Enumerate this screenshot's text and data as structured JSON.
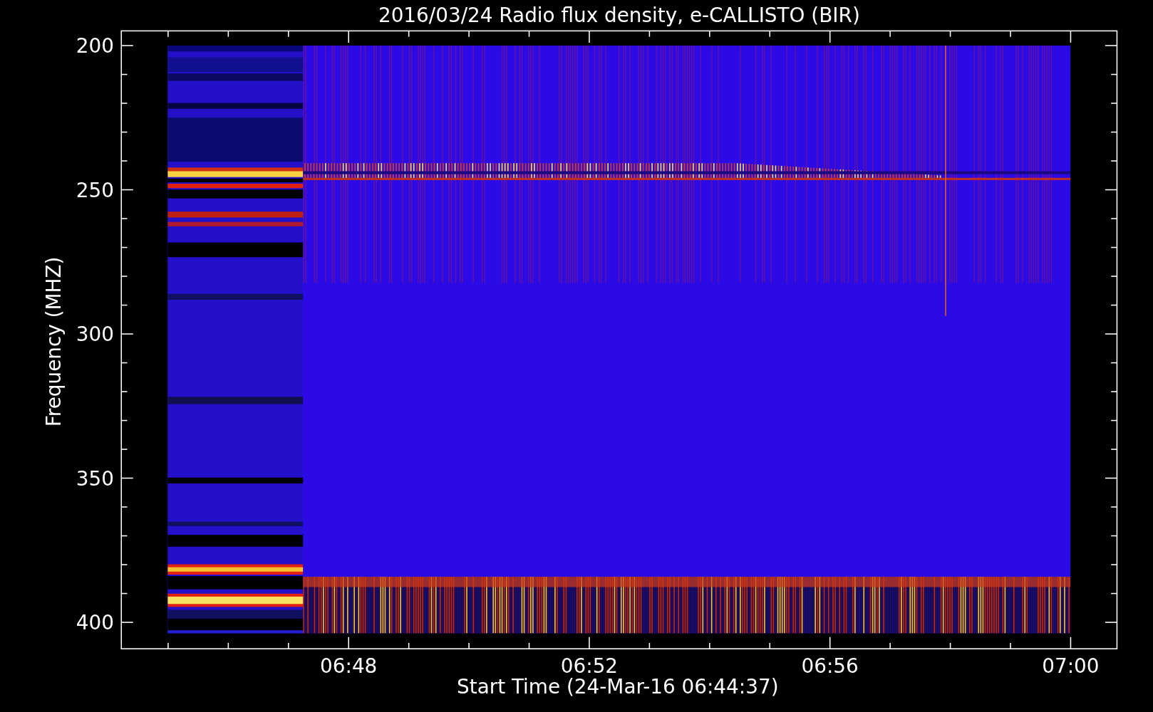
{
  "title": "2016/03/24  Radio flux density, e-CALLISTO (BIR)",
  "y_axis": {
    "label": "Frequency (MHZ)",
    "ticks": [
      "200",
      "250",
      "300",
      "350",
      "400"
    ]
  },
  "x_axis": {
    "label": "Start Time (24-Mar-16 06:44:37)",
    "ticks": [
      "06:48",
      "06:52",
      "06:56",
      "07:00"
    ]
  }
}
